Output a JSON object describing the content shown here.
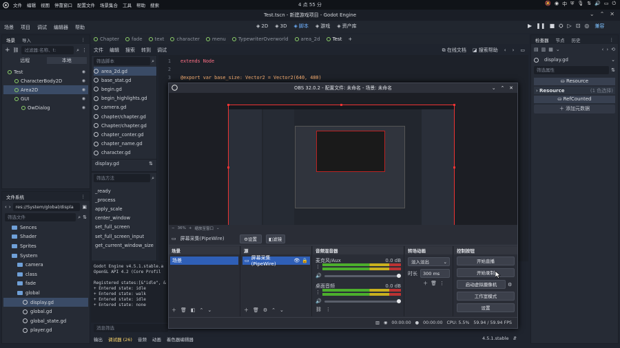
{
  "system": {
    "menu": [
      "文件",
      "编辑",
      "视图",
      "停靠窗口",
      "配置文件",
      "场景集合",
      "工具",
      "帮助",
      "搜索"
    ],
    "clock": "4 点 55 分",
    "tray_lang": "中"
  },
  "window": {
    "title": "Test.tscn - 新建游戏项目 - Godot Engine"
  },
  "godot": {
    "menu": [
      "场景",
      "项目",
      "调试",
      "编辑器",
      "帮助"
    ],
    "main_buttons": [
      {
        "label": "2D",
        "icon": "2d-icon"
      },
      {
        "label": "3D",
        "icon": "3d-icon"
      },
      {
        "label": "脚本",
        "icon": "script-icon",
        "active": true
      },
      {
        "label": "游戏",
        "icon": "game-icon"
      },
      {
        "label": "资产库",
        "icon": "assetlib-icon"
      }
    ],
    "renderer": "兼容"
  },
  "scene_dock": {
    "tabs": [
      "场景",
      "导入"
    ],
    "filter_placeholder": "过滤器:名称、t:",
    "remote": "远程",
    "local": "本地",
    "nodes": [
      {
        "label": "Test",
        "indent": 0
      },
      {
        "label": "CharacterBody2D",
        "indent": 1
      },
      {
        "label": "Area2D",
        "indent": 1,
        "selected": true
      },
      {
        "label": "GUI",
        "indent": 1
      },
      {
        "label": "OwDialog",
        "indent": 2
      }
    ]
  },
  "filesystem": {
    "title": "文件系统",
    "path": "res://System/global/displa",
    "filter_placeholder": "筛选文件",
    "items": [
      {
        "label": "Sences",
        "type": "folder",
        "indent": 1
      },
      {
        "label": "Shader",
        "type": "folder",
        "indent": 1
      },
      {
        "label": "Sprites",
        "type": "folder",
        "indent": 1
      },
      {
        "label": "System",
        "type": "folder",
        "indent": 1
      },
      {
        "label": "camera",
        "type": "folder",
        "indent": 2
      },
      {
        "label": "class",
        "type": "folder",
        "indent": 2
      },
      {
        "label": "fade",
        "type": "folder",
        "indent": 2
      },
      {
        "label": "global",
        "type": "folder",
        "indent": 2
      },
      {
        "label": "display.gd",
        "type": "gear",
        "indent": 3,
        "selected": true
      },
      {
        "label": "global.gd",
        "type": "gear",
        "indent": 3
      },
      {
        "label": "global_state.gd",
        "type": "gear",
        "indent": 3
      },
      {
        "label": "player.gd",
        "type": "gear",
        "indent": 3
      }
    ]
  },
  "script_editor": {
    "tabs": [
      "Chapter",
      "fade",
      "text",
      "character",
      "menu",
      "TypewriterOverworld",
      "area_2d",
      "Test"
    ],
    "menu": [
      "文件",
      "编辑",
      "搜索",
      "转到",
      "调试"
    ],
    "online_docs": "在线文档",
    "search_help": "搜索帮助",
    "filter_scripts": "筛选脚本",
    "scripts": [
      "area_2d.gd",
      "base_stat.gd",
      "begin.gd",
      "begin_highlights.gd",
      "camera.gd",
      "chapter/chapter.gd",
      "Chapter/chapter.gd",
      "chapter_conter.gd",
      "chapter_name.gd",
      "character.gd"
    ],
    "current_script": "display.gd",
    "filter_methods": "筛选方法",
    "methods": [
      "_ready",
      "_process",
      "apply_scale",
      "center_window",
      "set_full_screen",
      "set_full_screen_input",
      "get_current_window_size"
    ],
    "code_lines": [
      {
        "n": "1",
        "text": "extends Node"
      },
      {
        "n": "2",
        "text": ""
      },
      {
        "n": "3",
        "text": "@export var base_size: Vector2 = Vector2(640, 480)"
      }
    ]
  },
  "output": {
    "lines": [
      "Godot Engine v4.5.1.stable.a",
      "OpenGL API 4.2 (Core Profil",
      "",
      "Registered states:[&\"idle\", &",
      "+ Entered state: idle",
      "+ Entered state: walk",
      "+ Entered state: idle",
      "+ Entered state: none"
    ],
    "filter_placeholder": "消息筛选",
    "bottom_tabs": [
      "输出",
      "调试器 (26)",
      "音频",
      "动画",
      "着色器编辑器"
    ],
    "version": "4.5.1.stable"
  },
  "inspector": {
    "tabs": [
      "检查器",
      "节点",
      "历史"
    ],
    "file": "display.gd",
    "filter_placeholder": "筛选属性",
    "section_resource": "Resource",
    "subsection_resource": "Resource",
    "resource_count": "(1 色选择)",
    "refcounted": "RefCounted",
    "add_metadata": "添加元数据"
  },
  "obs": {
    "title": "OBS 32.0.2 - 配置文件: 未命名 - 场景: 未命名",
    "zoom_text": "36%",
    "fit_text": "缩放至窗口",
    "source_name": "屏幕采集(PipeWire)",
    "properties_btn": "设置",
    "filters_btn": "滤镜",
    "scenes_title": "场景",
    "scene_item": "场景",
    "sources_title": "源",
    "source_item": "屏幕采集(PipeWire)",
    "mixer_title": "音频混音器",
    "mixer": [
      {
        "name": "麦克风/Aux",
        "db": "0.0 dB"
      },
      {
        "name": "桌面音频",
        "db": "0.0 dB"
      }
    ],
    "transition_title": "转场动画",
    "transition": "淡入淡出",
    "duration_label": "时长",
    "duration": "300 ms",
    "controls_title": "控制按钮",
    "controls": [
      "开始直播",
      "开始录制",
      "启动虚拟摄像机",
      "工作室模式",
      "设置"
    ],
    "status": {
      "stream_time": "00:00:00",
      "rec_time": "00:00:00",
      "cpu": "CPU: 5.5%",
      "fps": "59.94 / 59.94 FPS"
    }
  }
}
